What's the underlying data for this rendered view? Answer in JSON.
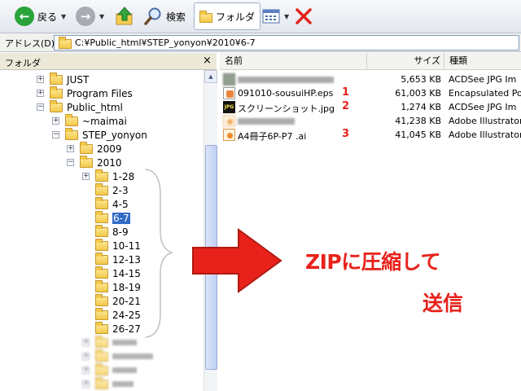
{
  "toolbar": {
    "back_label": "戻る",
    "search_label": "検索",
    "folders_label": "フォルダ"
  },
  "address": {
    "label": "アドレス(D)",
    "path": "C:¥Public_html¥STEP_yonyon¥2010¥6-7"
  },
  "folder_pane": {
    "title": "フォルダ",
    "close_glyph": "×",
    "nodes": [
      {
        "label": "JUST"
      },
      {
        "label": "Program Files"
      },
      {
        "label": "Public_html"
      },
      {
        "label": "~maimai"
      },
      {
        "label": "STEP_yonyon"
      },
      {
        "label": "2009"
      },
      {
        "label": "2010"
      },
      {
        "label": "1-28"
      },
      {
        "label": "2-3"
      },
      {
        "label": "4-5"
      },
      {
        "label": "6-7"
      },
      {
        "label": "8-9"
      },
      {
        "label": "10-11"
      },
      {
        "label": "12-13"
      },
      {
        "label": "14-15"
      },
      {
        "label": "18-19"
      },
      {
        "label": "20-21"
      },
      {
        "label": "24-25"
      },
      {
        "label": "26-27"
      }
    ]
  },
  "columns": {
    "name": "名前",
    "size": "サイズ",
    "type": "種類"
  },
  "files": [
    {
      "name": "",
      "size": "5,653 KB",
      "type": "ACDSee JPG Im",
      "marker": ""
    },
    {
      "name": "091010-sousuiHP.eps",
      "size": "61,003 KB",
      "type": "Encapsulated Po",
      "marker": "1"
    },
    {
      "name": "スクリーンショット.jpg",
      "size": "1,274 KB",
      "type": "ACDSee JPG Im",
      "marker": "2"
    },
    {
      "name": "",
      "size": "41,238 KB",
      "type": "Adobe Illustrator",
      "marker": ""
    },
    {
      "name": "A4冊子6P-P7 .ai",
      "size": "41,045 KB",
      "type": "Adobe Illustrator",
      "marker": "3"
    }
  ],
  "annotation": {
    "zip_text": "ZIPに圧縮して",
    "send_text": "送信",
    "color": "#e8221b"
  }
}
